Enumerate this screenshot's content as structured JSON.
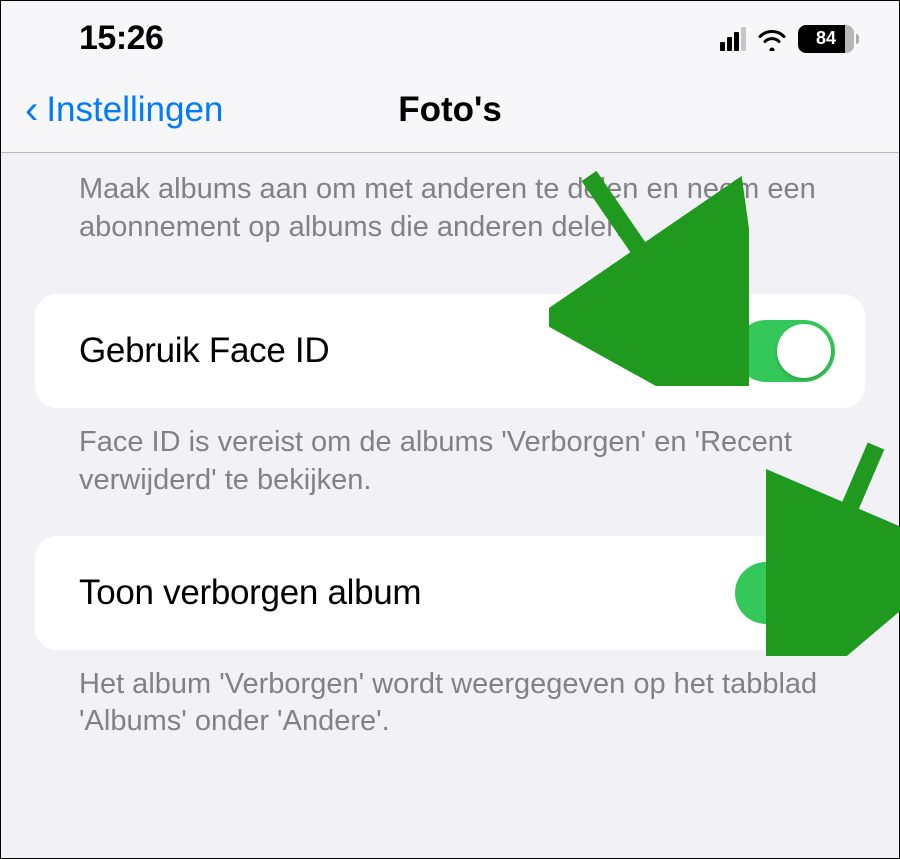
{
  "status": {
    "time": "15:26",
    "battery": "84"
  },
  "nav": {
    "back": "Instellingen",
    "title": "Foto's"
  },
  "intro": "Maak albums aan om met anderen te delen en neem een abonnement op albums die anderen delen.",
  "rows": [
    {
      "label": "Gebruik Face ID",
      "desc": "Face ID is vereist om de albums 'Verborgen' en 'Recent verwijderd' te bekijken."
    },
    {
      "label": "Toon verborgen album",
      "desc": "Het album 'Verborgen' wordt weergegeven op het tabblad 'Albums' onder 'Andere'."
    }
  ]
}
